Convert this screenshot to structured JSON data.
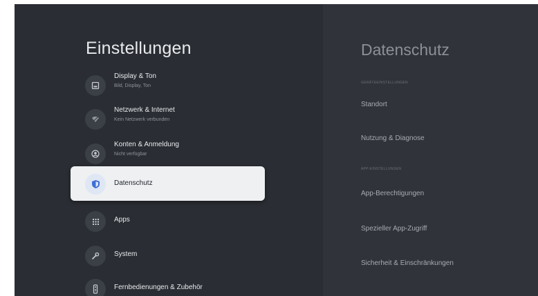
{
  "left": {
    "title": "Einstellungen",
    "items": [
      {
        "label": "Display & Ton",
        "sub": "Bild, Display, Ton",
        "icon": "display-icon"
      },
      {
        "label": "Netzwerk & Internet",
        "sub": "Kein Netzwerk verbunden",
        "icon": "wifi-icon"
      },
      {
        "label": "Konten & Anmeldung",
        "sub": "Nicht verfügbar",
        "icon": "account-icon"
      },
      {
        "label": "Datenschutz",
        "sub": "",
        "icon": "shield-icon",
        "selected": true
      },
      {
        "label": "Apps",
        "sub": "",
        "icon": "apps-grid-icon"
      },
      {
        "label": "System",
        "sub": "",
        "icon": "wrench-icon"
      },
      {
        "label": "Fernbedienungen & Zubehör",
        "sub": "",
        "icon": "remote-icon"
      }
    ]
  },
  "right": {
    "title": "Datenschutz",
    "section1": "Geräteeinstellungen",
    "item1": "Standort",
    "item2": "Nutzung & Diagnose",
    "section2": "App-Einstellungen",
    "item3": "App-Berechtigungen",
    "item4": "Spezieller App-Zugriff",
    "item5": "Sicherheit & Einschränkungen"
  },
  "colors": {
    "background": "#2a2d33",
    "right_panel": "#303339",
    "selected_bg": "#eef0f2",
    "accent": "#3d6fd6"
  }
}
